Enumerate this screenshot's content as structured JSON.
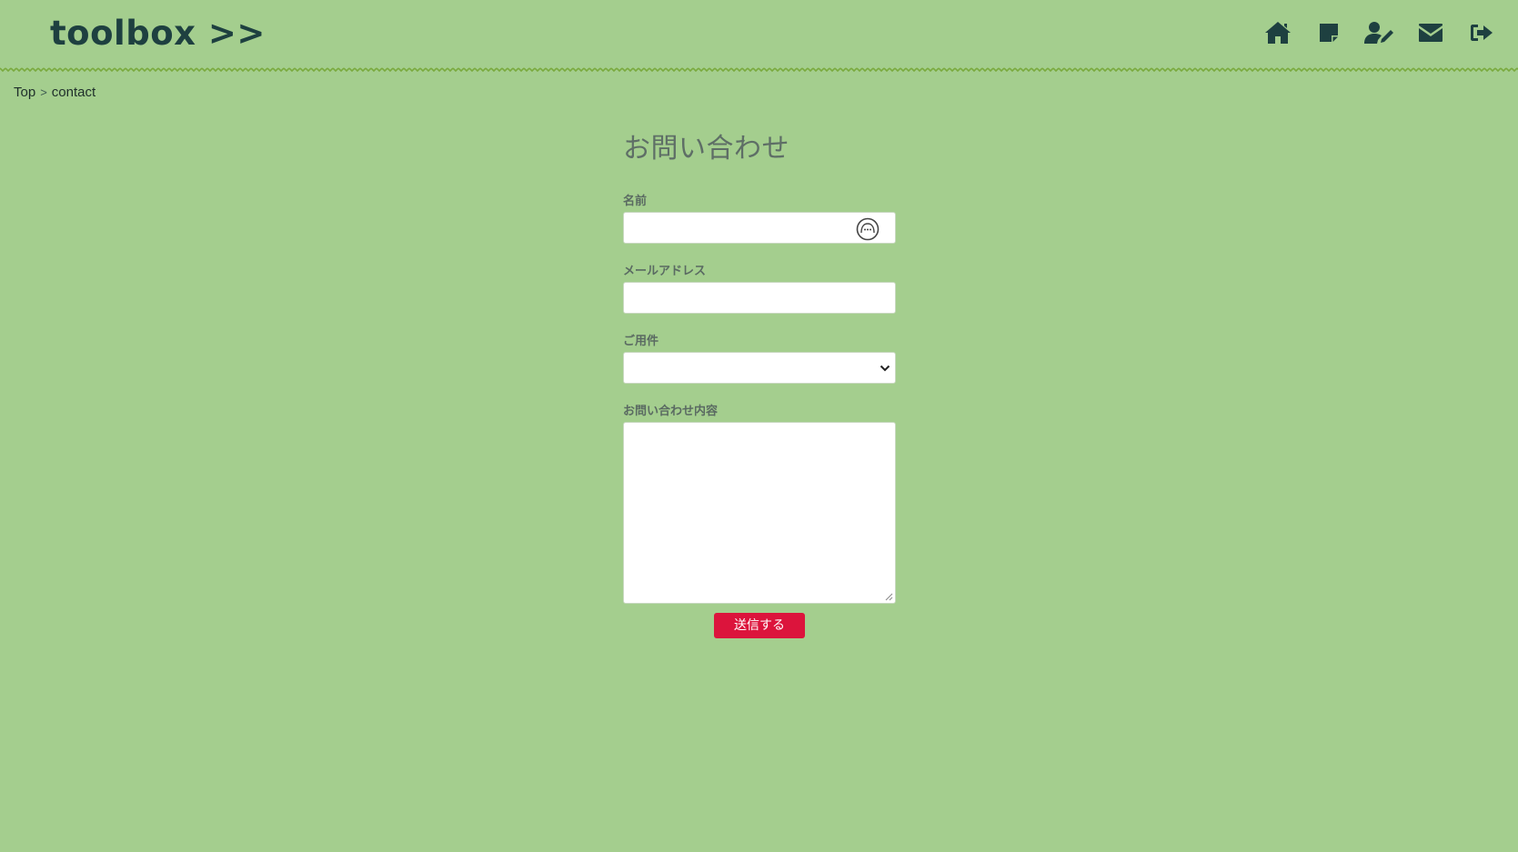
{
  "header": {
    "logo": "toolbox >>",
    "nav": [
      {
        "icon": "home-icon"
      },
      {
        "icon": "sticky-note-icon"
      },
      {
        "icon": "user-edit-icon"
      },
      {
        "icon": "envelope-icon"
      },
      {
        "icon": "sign-out-icon"
      }
    ]
  },
  "breadcrumb": {
    "top": "Top",
    "separator": ">",
    "current": "contact"
  },
  "form": {
    "title": "お問い合わせ",
    "name_label": "名前",
    "name_value": "",
    "email_label": "メールアドレス",
    "email_value": "",
    "subject_label": "ご用件",
    "subject_selected": "",
    "message_label": "お問い合わせ内容",
    "message_value": "",
    "submit_label": "送信する"
  },
  "colors": {
    "background": "#a4ce8e",
    "text_dark": "#1e4040",
    "submit_button": "#dc143c",
    "zigzag": "#7aaa3e"
  }
}
